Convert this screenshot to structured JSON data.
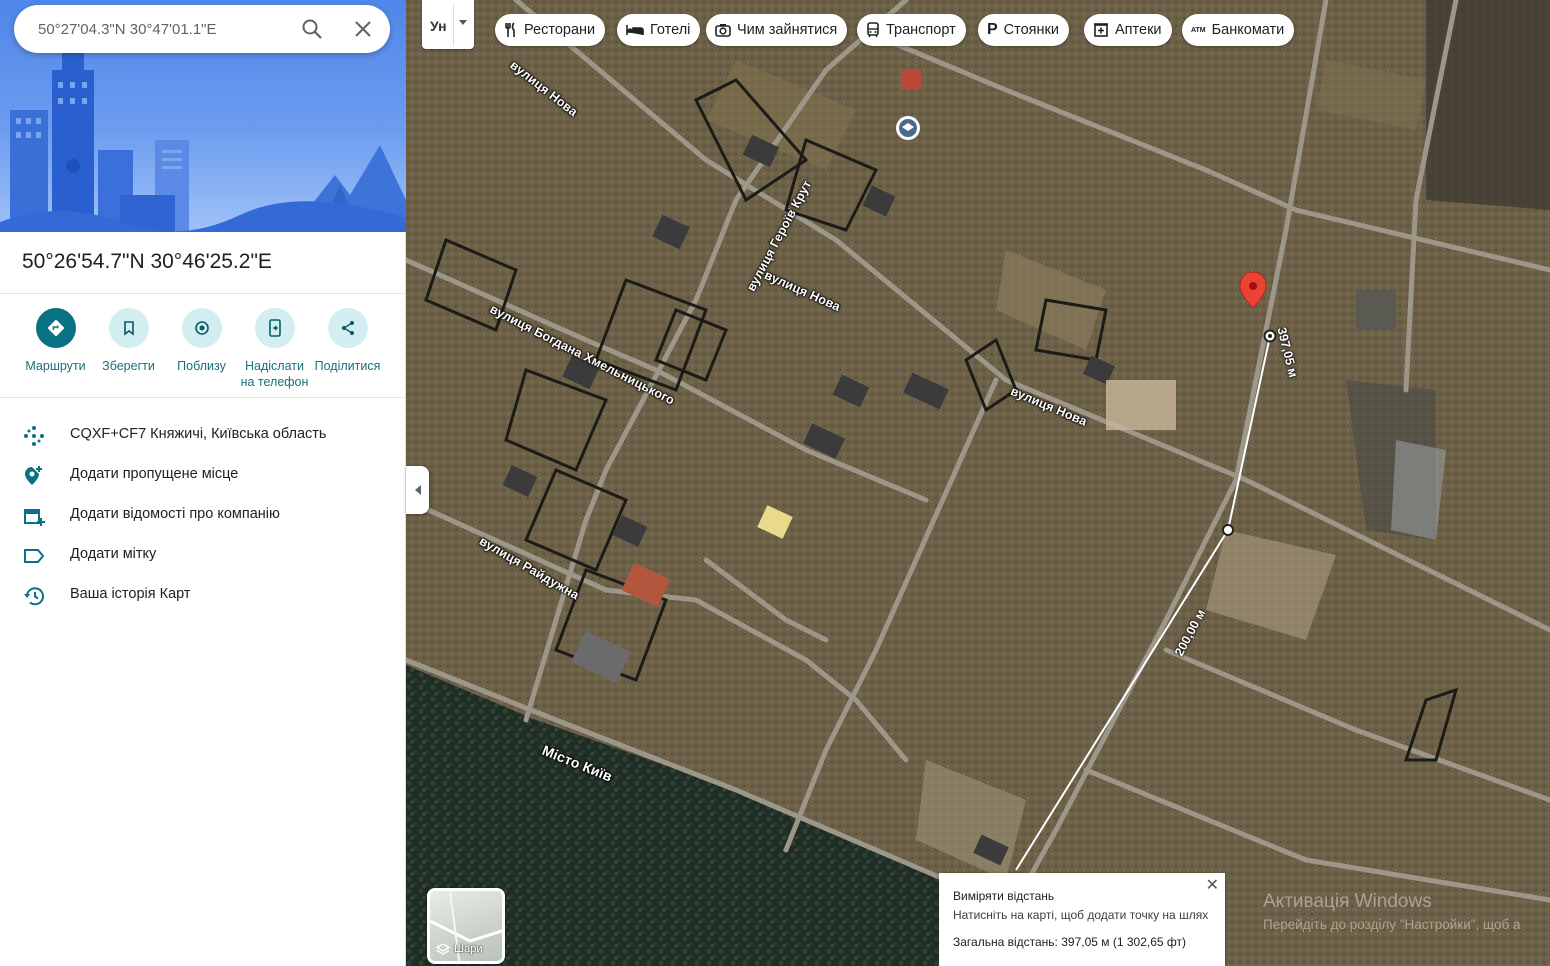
{
  "search": {
    "query": "50°27'04.3\"N 30°47'01.1\"E"
  },
  "place": {
    "title": "50°26'54.7\"N 30°46'25.2\"E"
  },
  "actions": [
    {
      "label": "Маршрути"
    },
    {
      "label": "Зберегти"
    },
    {
      "label": "Поблизу"
    },
    {
      "label": "Надіслати\nна телефон"
    },
    {
      "label": "Поділитися"
    }
  ],
  "info_rows": [
    {
      "text": "CQXF+CF7 Княжичі, Київська область",
      "icon": "plus-code-icon"
    },
    {
      "text": "Додати пропущене місце",
      "icon": "add-place-icon"
    },
    {
      "text": "Додати відомості про компанію",
      "icon": "add-business-icon"
    },
    {
      "text": "Додати мітку",
      "icon": "label-icon"
    },
    {
      "text": "Ваша історія Карт",
      "icon": "history-icon"
    }
  ],
  "map": {
    "lang_label": "Ун",
    "chips": [
      {
        "label": "Ресторани",
        "icon": "restaurant-icon"
      },
      {
        "label": "Готелі",
        "icon": "hotel-icon"
      },
      {
        "label": "Чим зайнятися",
        "icon": "camera-icon"
      },
      {
        "label": "Транспорт",
        "icon": "transit-icon"
      },
      {
        "label": "Стоянки",
        "icon": "parking-icon"
      },
      {
        "label": "Аптеки",
        "icon": "pharmacy-icon"
      },
      {
        "label": "Банкомати",
        "icon": "atm-icon"
      }
    ],
    "street_labels": [
      "вулиця Нова",
      "вулиця Героїв Крут",
      "вулиця Нова",
      "вулиця Богдана Хмельницького",
      "вулиця Нова",
      "вулиця Райдужна",
      "Місто Київ"
    ],
    "layers_label": "Шари",
    "distance_labels": [
      "397,05 м",
      "200,00 м"
    ],
    "measure": {
      "title": "Виміряти відстань",
      "hint": "Натисніть на карті, щоб додати точку на шлях",
      "total": "Загальна відстань: 397,05 м (1 302,65 фт)"
    },
    "watermark": {
      "line1": "Активація Windows",
      "line2": "Перейдіть до розділу \"Настройки\", щоб а"
    }
  }
}
